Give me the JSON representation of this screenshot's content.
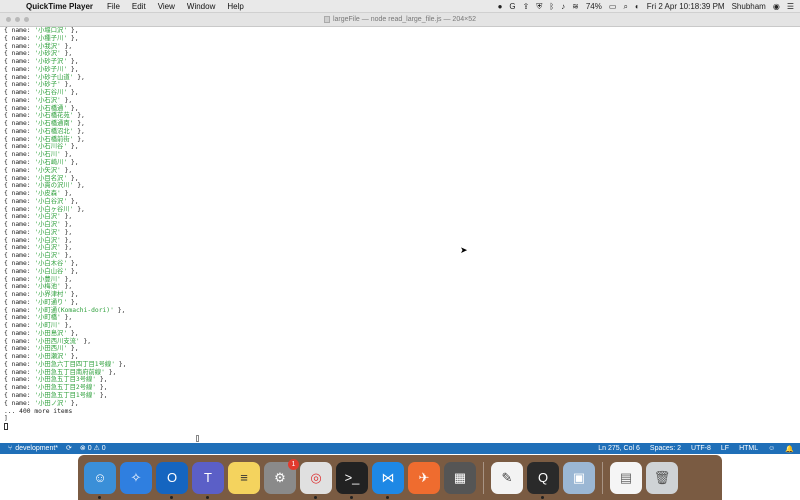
{
  "menubar": {
    "app_name": "QuickTime Player",
    "items": [
      "File",
      "Edit",
      "View",
      "Window",
      "Help"
    ],
    "battery": "74%",
    "datetime": "Fri 2 Apr  10:18:39 PM",
    "user": "Shubham"
  },
  "window": {
    "title": "largeFile — node read_large_file.js — 204×52"
  },
  "terminal": {
    "lines": [
      "{ name: '小堰口沢' },",
      "{ name: '小種子川' },",
      "{ name: '小我沢' },",
      "{ name: '小砂沢' },",
      "{ name: '小砂子沢' },",
      "{ name: '小砂子川' },",
      "{ name: '小砂子山道' },",
      "{ name: '小砂子' },",
      "{ name: '小石谷川' },",
      "{ name: '小石沢' },",
      "{ name: '小石橋通' },",
      "{ name: '小石橋花苑' },",
      "{ name: '小石橋通南' },",
      "{ name: '小石橋沼北' },",
      "{ name: '小石橋前街' },",
      "{ name: '小石川谷' },",
      "{ name: '小石川' },",
      "{ name: '小石崎川' },",
      "{ name: '小矢沢' },",
      "{ name: '小目名沢' },",
      "{ name: '小貫の沢川' },",
      "{ name: '小皮森' },",
      "{ name: '小白谷沢' },",
      "{ name: '小白ヶ谷川' },",
      "{ name: '小白沢' },",
      "{ name: '小白沢' },",
      "{ name: '小白沢' },",
      "{ name: '小白沢' },",
      "{ name: '小白沢' },",
      "{ name: '小白沢' },",
      "{ name: '小白木谷' },",
      "{ name: '小白山谷' },",
      "{ name: '小豊川' },",
      "{ name: '小梅池' },",
      "{ name: '小界津村' },",
      "{ name: '小町通り' },",
      "{ name: '小町通(Komachi-dori)' },",
      "{ name: '小町橋' },",
      "{ name: '小町川' },",
      "{ name: '小田島沢' },",
      "{ name: '小田西川支流' },",
      "{ name: '小田西川' },",
      "{ name: '小田瀬沢' },",
      "{ name: '小田急六丁目四丁目1号線' },",
      "{ name: '小田急五丁目南府前線' },",
      "{ name: '小田急五丁目3号線' },",
      "{ name: '小田急五丁目2号線' },",
      "{ name: '小田急五丁目1号線' },",
      "{ name: '小田ノ沢' },",
      "... 400 more items",
      "]"
    ]
  },
  "statusbar": {
    "branch": "development*",
    "problems": "⊗ 0 ⚠ 0",
    "position": "Ln 275, Col 6",
    "spaces": "Spaces: 2",
    "encoding": "UTF-8",
    "eol": "LF",
    "language": "HTML"
  },
  "dock": {
    "badge_count": "1",
    "icons": [
      "finder-icon",
      "safari-icon",
      "outlook-icon",
      "teams-icon",
      "notes-icon",
      "system-preferences-icon",
      "chrome-icon",
      "terminal-icon",
      "vscode-icon",
      "postman-icon",
      "calculator-icon",
      "textedit-icon",
      "quicktime-icon",
      "preview-icon",
      "document-icon",
      "trash-icon"
    ]
  },
  "colors": {
    "statusbar": "#1f6fb8",
    "string": "#2c9f3a",
    "dock": "#7a5b42"
  }
}
